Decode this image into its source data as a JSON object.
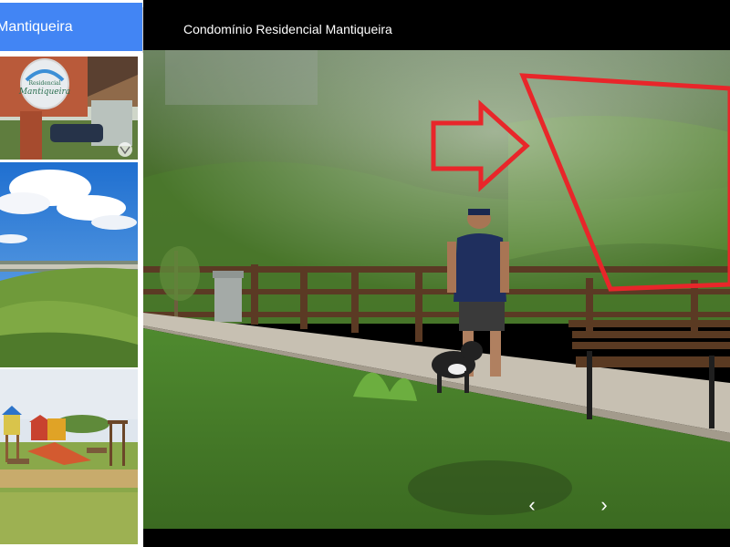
{
  "sidebar": {
    "header_title": "Mantiqueira",
    "thumbnails": [
      {
        "kind": "entrance-sign",
        "sign_text": [
          "Residencial",
          "Mantiqueira"
        ]
      },
      {
        "kind": "hillside-landscape"
      },
      {
        "kind": "playground"
      }
    ]
  },
  "viewer": {
    "title": "Condomínio Residencial Mantiqueira",
    "prev_glyph": "‹",
    "next_glyph": "›"
  },
  "colors": {
    "header_blue": "#4285f4",
    "annotation_red": "#e8262a",
    "viewer_bg": "#000000"
  }
}
